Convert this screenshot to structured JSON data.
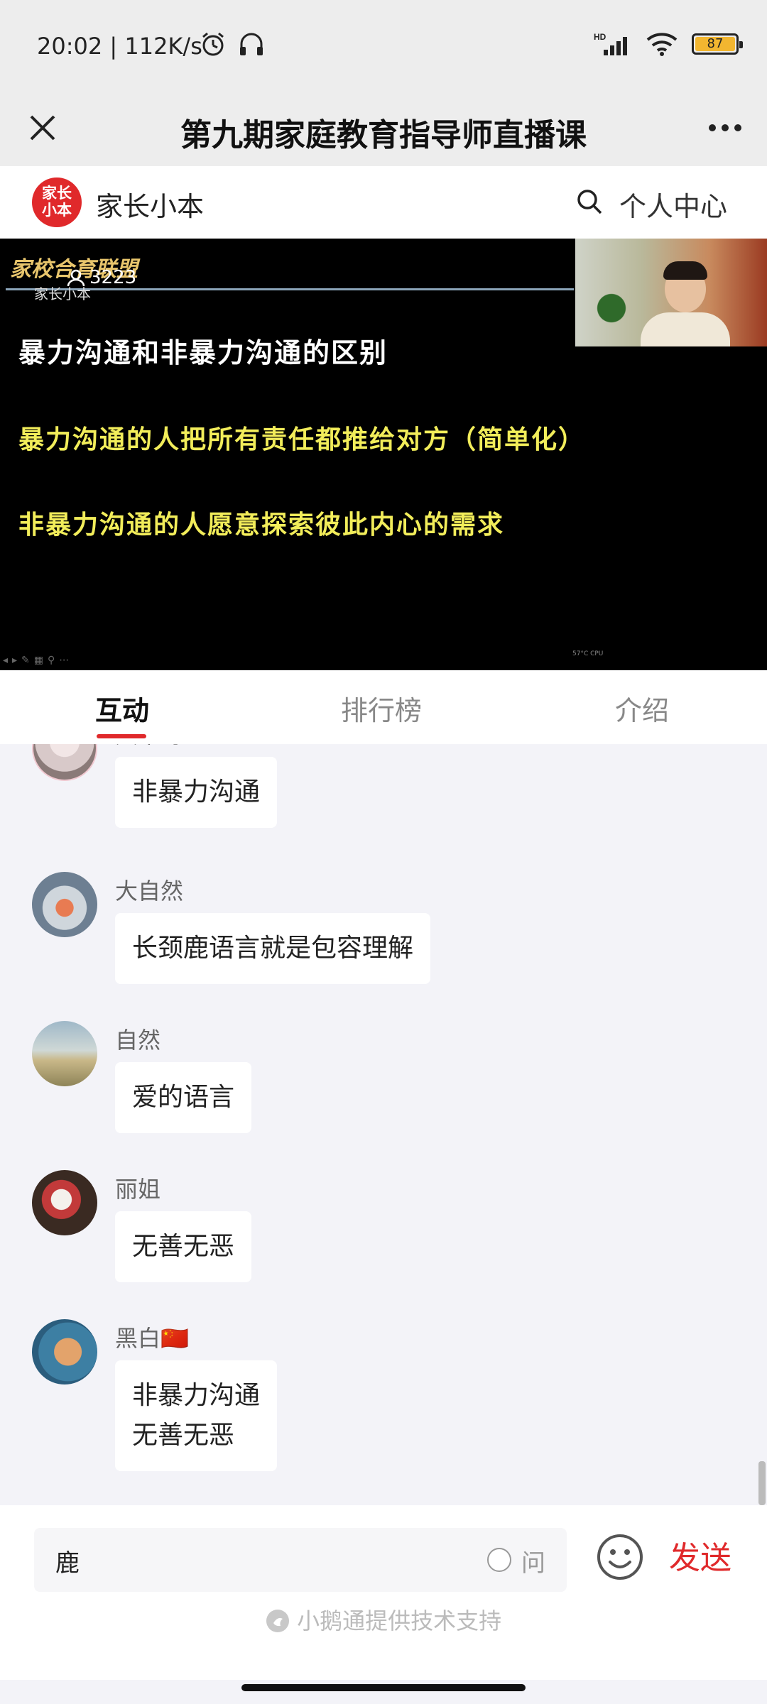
{
  "status_bar": {
    "time": "20:02",
    "network_speed": "112K/s",
    "battery_level": "87",
    "icons": [
      "alarm-icon",
      "headphones-icon",
      "hd-signal-icon",
      "wifi-icon",
      "battery-icon"
    ]
  },
  "title_bar": {
    "title": "第九期家庭教育指导师直播课",
    "close_icon": "close-icon",
    "more_icon": "more-icon"
  },
  "brand": {
    "logo_text": "家长小本",
    "name": "家长小本",
    "search_icon": "search-icon",
    "personal_center": "个人中心"
  },
  "video": {
    "brand_text": "家校合育联盟",
    "sub_text": "家长小本",
    "viewer_count": "3223",
    "slide_title": "暴力沟通和非暴力沟通的区别",
    "slide_line1": "暴力沟通的人把所有责任都推给对方（简单化）",
    "slide_line2": "非暴力沟通的人愿意探索彼此内心的需求",
    "controls": "◂▸✎▦⚲⋯",
    "tag": "57°C CPU",
    "colors": {
      "slide_text": "#f2ed5a",
      "title_text": "#ffffff"
    }
  },
  "tabs": [
    {
      "label": "互动",
      "active": true
    },
    {
      "label": "排行榜",
      "active": false
    },
    {
      "label": "介绍",
      "active": false
    }
  ],
  "messages": [
    {
      "username": "大草莓",
      "text": "非暴力沟通",
      "avatar": "avatar-photo"
    },
    {
      "username": "大自然",
      "text": "长颈鹿语言就是包容理解",
      "avatar": "avatar-photo"
    },
    {
      "username": "自然",
      "text": "爱的语言",
      "avatar": "avatar-photo"
    },
    {
      "username": "丽姐",
      "text": "无善无恶",
      "avatar": "avatar-photo"
    },
    {
      "username": "黑白🇨🇳",
      "text_line1": "非暴力沟通",
      "text_line2": "无善无恶",
      "avatar": "avatar-photo"
    }
  ],
  "input": {
    "value": "鹿",
    "ask_label": "问",
    "emoji_icon": "emoji-icon",
    "send_label": "发送"
  },
  "footer": {
    "powered_by": "小鹅通提供技术支持"
  },
  "colors": {
    "accent": "#e0292b",
    "background": "#f3f3f8"
  }
}
